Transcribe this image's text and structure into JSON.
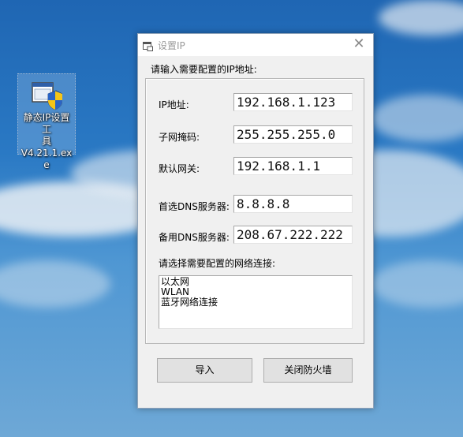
{
  "desktop": {
    "icon_label": "静态IP设置工具V4.21.1.exe",
    "icon_label_lines": [
      "静态IP设置工",
      "具",
      "V4.21.1.exe"
    ]
  },
  "window": {
    "title": "设置IP",
    "close_symbol": "✕",
    "prompt": "请输入需要配置的IP地址:",
    "fields": {
      "ip": {
        "label": "IP地址:",
        "value": "192.168.1.123"
      },
      "mask": {
        "label": "子网掩码:",
        "value": "255.255.255.0"
      },
      "gateway": {
        "label": "默认网关:",
        "value": "192.168.1.1"
      },
      "dns1": {
        "label": "首选DNS服务器:",
        "value": "8.8.8.8"
      },
      "dns2": {
        "label": "备用DNS服务器:",
        "value": "208.67.222.222"
      }
    },
    "connection_prompt": "请选择需要配置的网络连接:",
    "connections": [
      "以太网",
      "WLAN",
      "蓝牙网络连接"
    ],
    "buttons": {
      "import": "导入",
      "firewall": "关闭防火墙"
    }
  },
  "colors": {
    "desktop_sky": "#2a79c4",
    "window_bg": "#f0f0f0",
    "button_bg": "#e1e1e1"
  }
}
